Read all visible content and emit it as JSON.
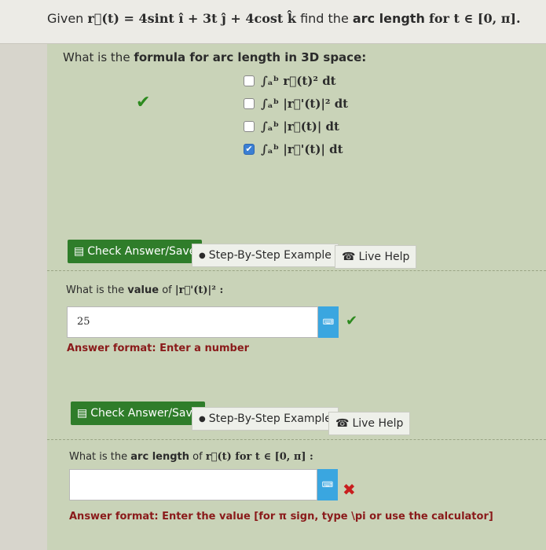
{
  "header": {
    "given": "Given",
    "function": "r⃗(t) = 4sint î + 3t ĵ + 4cost k̂",
    "find": "find the",
    "arc_length_bold": "arc length",
    "for_range": "for t ∈ [0, π]."
  },
  "question1": {
    "prefix": "What is the",
    "bold": "formula for arc length in 3D space:",
    "options": [
      {
        "label": "∫ₐᵇ r⃗(t)² dt",
        "checked": false
      },
      {
        "label": "∫ₐᵇ |r⃗'(t)|² dt",
        "checked": false
      },
      {
        "label": "∫ₐᵇ |r⃗(t)| dt",
        "checked": false
      },
      {
        "label": "∫ₐᵇ |r⃗'(t)| dt",
        "checked": true
      }
    ]
  },
  "buttons": {
    "check_answer": "Check Answer/Save",
    "step_by_step": "Step-By-Step Example",
    "live_help": "Live Help"
  },
  "question2": {
    "prefix": "What is the",
    "bold": "value",
    "of": "of",
    "expr": "|r⃗'(t)|² :",
    "answer": "25",
    "format": "Answer format: Enter a number"
  },
  "question3": {
    "prefix": "What is the",
    "bold": "arc length",
    "of": "of",
    "expr": "r⃗(t)  for t ∈ [0, π] :",
    "answer": "",
    "format": "Answer format: Enter the value [for π sign, type \\pi or use the calculator]"
  },
  "icons": {
    "check": "✔",
    "x": "✖",
    "info": "●",
    "phone": "☎",
    "save": "▤"
  }
}
